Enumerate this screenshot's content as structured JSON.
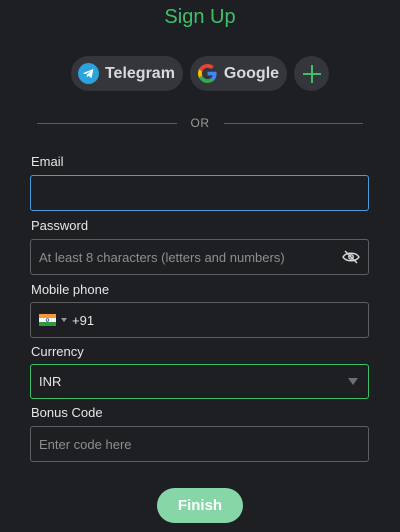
{
  "page": {
    "title": "Sign Up"
  },
  "social": {
    "telegram_label": "Telegram",
    "google_label": "Google"
  },
  "divider": {
    "text": "OR"
  },
  "form": {
    "email": {
      "label": "Email",
      "value": "",
      "placeholder": ""
    },
    "password": {
      "label": "Password",
      "placeholder": "At least 8 characters (letters and numbers)"
    },
    "mobile": {
      "label": "Mobile phone",
      "dial_code": "+91",
      "value": ""
    },
    "currency": {
      "label": "Currency",
      "selected": "INR"
    },
    "bonus": {
      "label": "Bonus Code",
      "placeholder": "Enter code here"
    }
  },
  "actions": {
    "finish_label": "Finish"
  },
  "colors": {
    "accent": "#3ec06a",
    "focus": "#4a9ad6",
    "finish_bg": "#86d6a7",
    "background": "#1e1f23"
  }
}
